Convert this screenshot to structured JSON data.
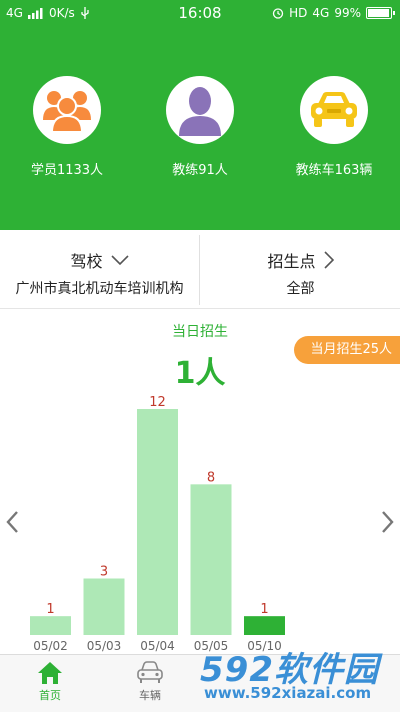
{
  "status_bar": {
    "network": "4G",
    "speed": "0K/s",
    "time": "16:08",
    "hd": "HD",
    "net2": "4G",
    "battery": "99%"
  },
  "stats": [
    {
      "label": "学员1133人",
      "icon": "students-icon"
    },
    {
      "label": "教练91人",
      "icon": "coach-icon"
    },
    {
      "label": "教练车163辆",
      "icon": "car-icon"
    }
  ],
  "selectors": {
    "school": {
      "title": "驾校",
      "value": "广州市真北机动车培训机构"
    },
    "site": {
      "title": "招生点",
      "value": "全部"
    }
  },
  "daily": {
    "label": "当日招生",
    "value": "1人"
  },
  "month_badge": "当月招生25人",
  "chart_data": {
    "type": "bar",
    "categories": [
      "05/02",
      "05/03",
      "05/04",
      "05/05",
      "05/10"
    ],
    "values": [
      1,
      3,
      12,
      8,
      1
    ],
    "highlight_index": 4,
    "colors": {
      "bar": "#aee8b6",
      "highlight": "#2eb135",
      "label": "#c0392b"
    }
  },
  "tabs": [
    {
      "label": "首页",
      "icon": "home-icon",
      "active": true
    },
    {
      "label": "车辆",
      "icon": "car-outline-icon",
      "active": false
    }
  ],
  "watermark": {
    "logo": "592软件园",
    "url": "www.592xiazai.com"
  },
  "colors": {
    "primary": "#2eb135",
    "accent": "#f7a13b"
  }
}
